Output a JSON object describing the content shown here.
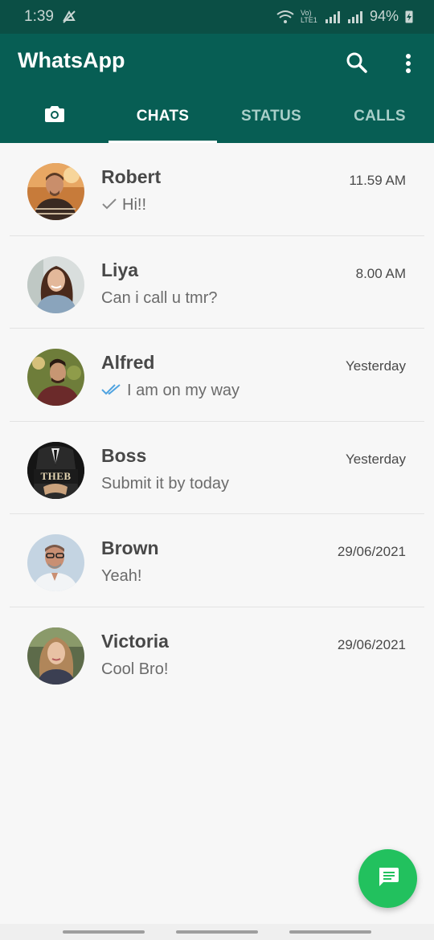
{
  "status_bar": {
    "time": "1:39",
    "network_label": "Vo) LTE1",
    "battery": "94%"
  },
  "app": {
    "title": "WhatsApp",
    "brand_color": "#075e54",
    "fab_color": "#22c15e"
  },
  "tabs": [
    {
      "label": "CHATS",
      "active": true
    },
    {
      "label": "STATUS",
      "active": false
    },
    {
      "label": "CALLS",
      "active": false
    }
  ],
  "chats": [
    {
      "name": "Robert",
      "time": "11.59 AM",
      "message": "Hi!!",
      "tick": "single-check-icon"
    },
    {
      "name": "Liya",
      "time": "8.00 AM",
      "message": "Can i call u tmr?",
      "tick": ""
    },
    {
      "name": "Alfred",
      "time": "Yesterday",
      "message": "I am on my way",
      "tick": "double-check-blue-icon"
    },
    {
      "name": "Boss",
      "time": "Yesterday",
      "message": "Submit it by today",
      "tick": "",
      "avatar_text": "THEB"
    },
    {
      "name": "Brown",
      "time": "29/06/2021",
      "message": "Yeah!",
      "tick": ""
    },
    {
      "name": "Victoria",
      "time": "29/06/2021",
      "message": "Cool Bro!",
      "tick": ""
    }
  ],
  "icons": {
    "search": "search-icon",
    "menu": "more-vert-icon",
    "camera": "camera-icon",
    "new_chat": "message-icon"
  }
}
